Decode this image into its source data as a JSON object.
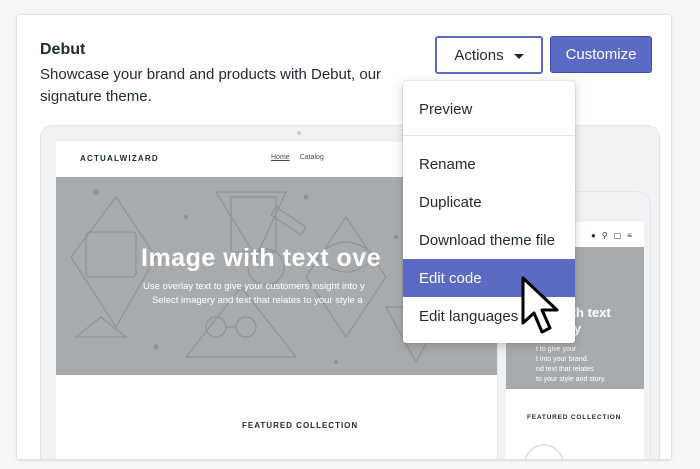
{
  "theme": {
    "title": "Debut",
    "description": "Showcase your brand and products with Debut, our signature theme."
  },
  "buttons": {
    "actions_label": "Actions",
    "customize_label": "Customize"
  },
  "actions_menu": {
    "items": [
      {
        "label": "Preview"
      },
      {
        "label": "Rename"
      },
      {
        "label": "Duplicate"
      },
      {
        "label": "Download theme file"
      },
      {
        "label": "Edit code",
        "highlighted": true
      },
      {
        "label": "Edit languages"
      }
    ]
  },
  "preview": {
    "store_name": "ACTUALWIZARD",
    "nav": [
      "Home",
      "Catalog"
    ],
    "hero_title": "Image with text ove",
    "hero_line1": "Use overlay text to give your customers insight into y",
    "hero_line2": "Select imagery and text that relates to your style a",
    "featured": "FEATURED COLLECTION"
  },
  "mobile_preview": {
    "hero_title_line1": "with text",
    "hero_title_line2": "rlay",
    "hero_sub_line1": "t to give your",
    "hero_sub_line2": "t into your brand.",
    "hero_sub_line3": "nd text that relates",
    "hero_sub_line4": "to your style and story.",
    "featured": "FEATURED COLLECTION"
  },
  "colors": {
    "primary": "#5c6ac4",
    "hero_gray": "#a8abad",
    "text": "#212b36"
  }
}
